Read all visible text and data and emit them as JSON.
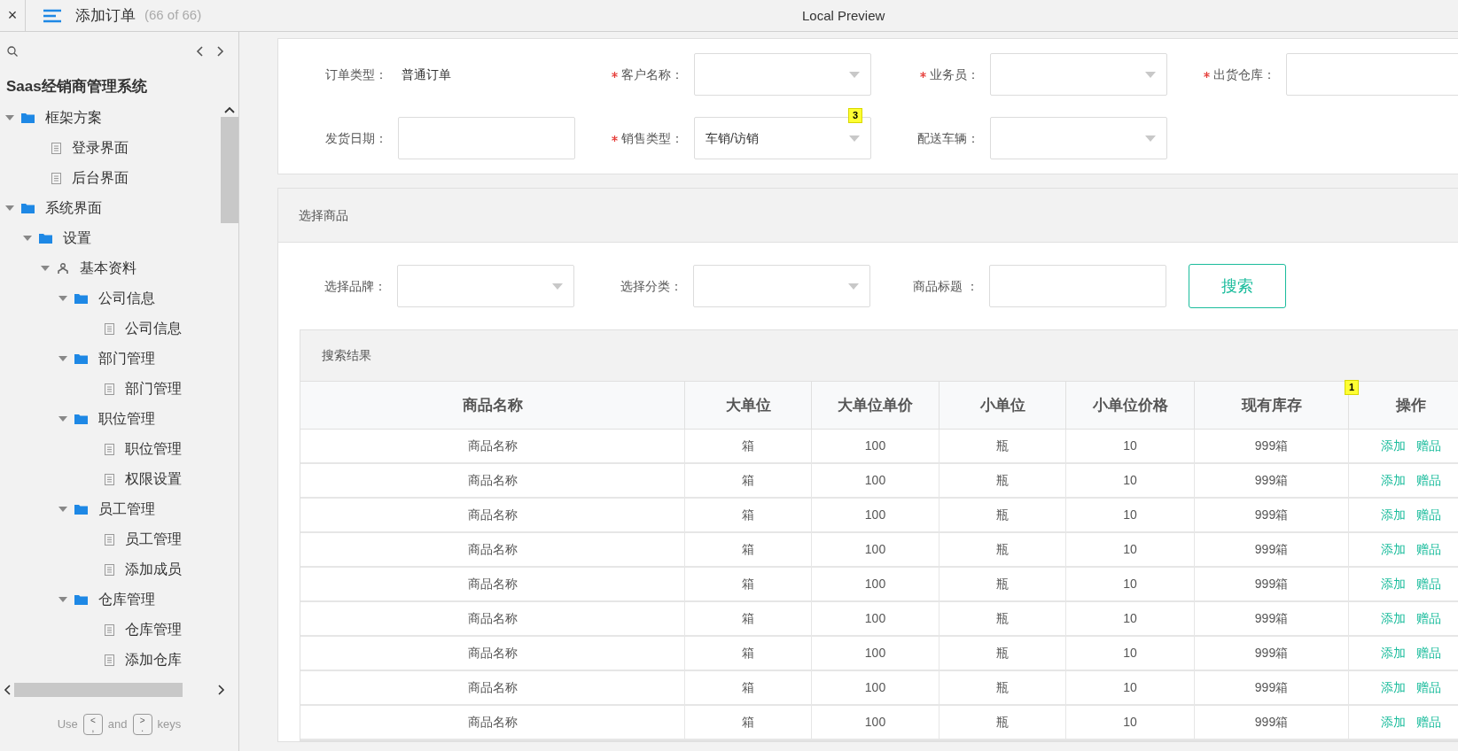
{
  "top_bar": {
    "close": "×",
    "title": "添加订单",
    "count": "(66 of 66)",
    "preview": "Local Preview"
  },
  "sidebar": {
    "project": "Saas经销商管理系统",
    "tree": [
      {
        "kind": "folder",
        "label": "框架方案",
        "expanded": true,
        "children": [
          {
            "kind": "page",
            "label": "登录界面"
          },
          {
            "kind": "page",
            "label": "后台界面"
          }
        ]
      },
      {
        "kind": "folder",
        "label": "系统界面",
        "expanded": true,
        "children": [
          {
            "kind": "folder",
            "label": "设置",
            "expanded": true,
            "children": [
              {
                "kind": "group",
                "label": "基本资料",
                "expanded": true,
                "children": [
                  {
                    "kind": "folder",
                    "label": "公司信息",
                    "expanded": true,
                    "children": [
                      {
                        "kind": "page",
                        "label": "公司信息"
                      }
                    ]
                  },
                  {
                    "kind": "folder",
                    "label": "部门管理",
                    "expanded": true,
                    "children": [
                      {
                        "kind": "page",
                        "label": "部门管理"
                      }
                    ]
                  },
                  {
                    "kind": "folder",
                    "label": "职位管理",
                    "expanded": true,
                    "children": [
                      {
                        "kind": "page",
                        "label": "职位管理"
                      },
                      {
                        "kind": "page",
                        "label": "权限设置"
                      }
                    ]
                  },
                  {
                    "kind": "folder",
                    "label": "员工管理",
                    "expanded": true,
                    "children": [
                      {
                        "kind": "page",
                        "label": "员工管理"
                      },
                      {
                        "kind": "page",
                        "label": "添加成员"
                      }
                    ]
                  },
                  {
                    "kind": "folder",
                    "label": "仓库管理",
                    "expanded": true,
                    "children": [
                      {
                        "kind": "page",
                        "label": "仓库管理"
                      },
                      {
                        "kind": "page",
                        "label": "添加仓库"
                      }
                    ]
                  }
                ]
              }
            ]
          }
        ]
      }
    ],
    "footer": {
      "before": "Use",
      "key1": [
        "<",
        ","
      ],
      "middle": "and",
      "key2": [
        ">",
        "."
      ],
      "after": "keys"
    }
  },
  "order_form": {
    "rows": [
      [
        {
          "kind": "text",
          "label": "订单类型：",
          "value": "普通订单",
          "required": false
        },
        {
          "kind": "select",
          "label": "客户名称：",
          "required": true
        },
        {
          "kind": "select",
          "label": "业务员：",
          "required": true
        },
        {
          "kind": "input",
          "label": "出货仓库：",
          "required": true
        }
      ],
      [
        {
          "kind": "input",
          "label": "发货日期：",
          "required": false
        },
        {
          "kind": "select",
          "label": "销售类型：",
          "value": "车销/访销",
          "required": true,
          "badge": "3"
        },
        {
          "kind": "select",
          "label": "配送车辆：",
          "required": false
        }
      ]
    ]
  },
  "goods": {
    "title": "选择商品",
    "filters": [
      {
        "kind": "select",
        "label": "选择品牌："
      },
      {
        "kind": "select",
        "label": "选择分类："
      },
      {
        "kind": "input",
        "label": "商品标题 ："
      }
    ],
    "search_button": "搜索",
    "results": {
      "title": "搜索结果",
      "columns": [
        {
          "label": "商品名称"
        },
        {
          "label": "大单位"
        },
        {
          "label": "大单位单价"
        },
        {
          "label": "小单位"
        },
        {
          "label": "小单位价格"
        },
        {
          "label": "现有库存",
          "badge": "1"
        },
        {
          "label": "操作"
        }
      ],
      "rows": [
        [
          "商品名称",
          "箱",
          "100",
          "瓶",
          "10",
          "999箱",
          [
            "添加",
            "赠品"
          ]
        ],
        [
          "商品名称",
          "箱",
          "100",
          "瓶",
          "10",
          "999箱",
          [
            "添加",
            "赠品"
          ]
        ],
        [
          "商品名称",
          "箱",
          "100",
          "瓶",
          "10",
          "999箱",
          [
            "添加",
            "赠品"
          ]
        ],
        [
          "商品名称",
          "箱",
          "100",
          "瓶",
          "10",
          "999箱",
          [
            "添加",
            "赠品"
          ]
        ],
        [
          "商品名称",
          "箱",
          "100",
          "瓶",
          "10",
          "999箱",
          [
            "添加",
            "赠品"
          ]
        ],
        [
          "商品名称",
          "箱",
          "100",
          "瓶",
          "10",
          "999箱",
          [
            "添加",
            "赠品"
          ]
        ],
        [
          "商品名称",
          "箱",
          "100",
          "瓶",
          "10",
          "999箱",
          [
            "添加",
            "赠品"
          ]
        ],
        [
          "商品名称",
          "箱",
          "100",
          "瓶",
          "10",
          "999箱",
          [
            "添加",
            "赠品"
          ]
        ],
        [
          "商品名称",
          "箱",
          "100",
          "瓶",
          "10",
          "999箱",
          [
            "添加",
            "赠品"
          ]
        ]
      ]
    }
  }
}
